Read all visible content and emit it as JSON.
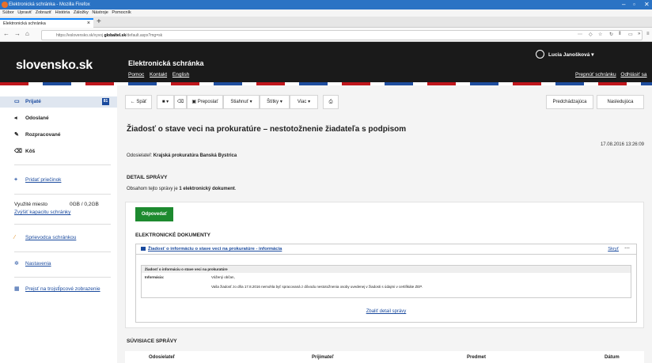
{
  "browser": {
    "window_title": "Elektronická schránka - Mozilla Firefox",
    "menu": [
      "Súbor",
      "Upraviť",
      "Zobraziť",
      "História",
      "Záložky",
      "Nástroje",
      "Pomocník"
    ],
    "tab_title": "Elektronická schránka",
    "url_prefix": "https://eslovensko.sk/default.aspx?mg=sk",
    "url_host": "globaltel.sk",
    "url_prefix_host": "https://eslovensko.sk/vyvoj.",
    "url_path": "/default.aspx?mg=sk",
    "url_suffix": "/default.aspx?mg=sk"
  },
  "header": {
    "logo": "slovensko.sk",
    "app_title": "Elektronická schránka",
    "links": [
      "Pomoc",
      "Kontakt",
      "English"
    ],
    "user_name": "Lucia Janošková",
    "switch_box": "Prepnúť schránku",
    "logout": "Odhlásiť sa"
  },
  "sidebar": {
    "items": [
      {
        "label": "Prijaté",
        "badge": "81"
      },
      {
        "label": "Odoslané"
      },
      {
        "label": "Rozpracované"
      },
      {
        "label": "Kôš"
      }
    ],
    "add_folder": "Pridať priečinok",
    "storage_label": "Využité miesto",
    "storage_value": "0GB / 0,2GB",
    "increase_capacity": "Zvýšiť kapacitu schránky",
    "guide": "Sprievodca schránkou",
    "settings": "Nastavenia",
    "two_column": "Prejsť na trojstĺpcové zobrazenie"
  },
  "toolbar": {
    "back": "← Späť",
    "forward": "Preposlať",
    "download": "Stiahnuť",
    "tags": "Štítky",
    "more": "Viac",
    "previous": "Predchádzajúca",
    "next": "Nasledujúca"
  },
  "message": {
    "title": "Žiadosť o stave veci na prokuratúre – nestotožnenie žiadateľa s podpisom",
    "date": "17.08.2016 13:26:09",
    "sender_label": "Odosielateľ:",
    "sender_value": "Krajská prokuratúra Banská Bystrica",
    "detail_heading": "DETAIL SPRÁVY",
    "detail_text_prefix": "Obsahom tejto správy je ",
    "detail_text_bold": "1 elektronický dokument",
    "detail_text_suffix": ".",
    "reply": "Odpovedať",
    "documents_heading": "ELEKTRONICKÉ DOKUMENTY",
    "document_title": "Žiadosť o informáciu o stave veci na prokuratúre - informácia",
    "hide": "Skryť",
    "more_icon": "⋯",
    "inner_heading": "Žiadosť o informáciu o stave veci na prokuratúre",
    "info_label": "Informácia:",
    "info_line1": "Vážený občan,",
    "info_line2": "Vaša žiadosť zo dňa 17.8.2016 nemohla byť spracovaná z dôvodu nestotožnenia osoby uvedenej v žiadosti s údajmi v certifikáte ZEP.",
    "show_detail": "Zbaliť detail správy",
    "related_heading": "SÚVISIACE SPRÁVY",
    "col_sender": "Odosielateľ",
    "col_recipient": "Prijímateľ",
    "col_subject": "Predmet",
    "col_date": "Dátum"
  },
  "colors": {
    "header_bg": "#1a1a1a",
    "accent_blue": "#1a4a9e",
    "reply_green": "#1d8a2f",
    "stripe_red": "#c0161c",
    "titlebar": "#2b73c4"
  }
}
